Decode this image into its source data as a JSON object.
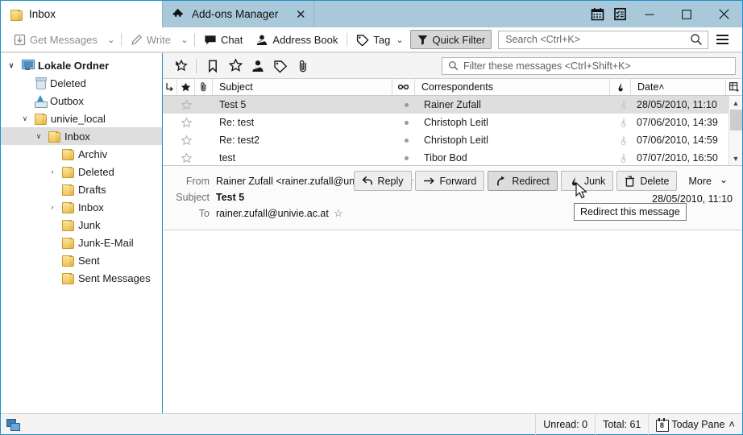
{
  "window": {
    "title_icons": [
      "calendar-icon",
      "tasks-icon"
    ],
    "controls": {
      "minimize": "minimize-icon",
      "maximize": "maximize-icon",
      "close": "close-icon"
    }
  },
  "tabs": [
    {
      "label": "Inbox",
      "icon": "folder-icon",
      "active": false,
      "closable": false
    },
    {
      "label": "Add-ons Manager",
      "icon": "puzzle-piece-icon",
      "active": true,
      "closable": true,
      "close_label": "✕"
    }
  ],
  "toolbar": {
    "get_messages": "Get Messages",
    "write": "Write",
    "chat": "Chat",
    "address_book": "Address Book",
    "tag": "Tag",
    "quick_filter": "Quick Filter",
    "caret": "⌄"
  },
  "search": {
    "placeholder": "Search <Ctrl+K>",
    "value": ""
  },
  "sidebar": {
    "items": [
      {
        "label": "Lokale Ordner",
        "icon": "monitor-icon",
        "indent": 0,
        "twisty": "∨",
        "bold": true,
        "selected": false
      },
      {
        "label": "Deleted",
        "icon": "trash-icon",
        "indent": 1,
        "twisty": "",
        "bold": false,
        "selected": false
      },
      {
        "label": "Outbox",
        "icon": "outbox-icon",
        "indent": 1,
        "twisty": "",
        "bold": false,
        "selected": false
      },
      {
        "label": "univie_local",
        "icon": "folder-icon",
        "indent": 1,
        "twisty": "∨",
        "bold": false,
        "selected": false
      },
      {
        "label": "Inbox",
        "icon": "folder-icon",
        "indent": 2,
        "twisty": "∨",
        "bold": false,
        "selected": true
      },
      {
        "label": "Archiv",
        "icon": "folder-icon",
        "indent": 3,
        "twisty": "",
        "bold": false,
        "selected": false
      },
      {
        "label": "Deleted",
        "icon": "folder-icon",
        "indent": 3,
        "twisty": "›",
        "bold": false,
        "selected": false
      },
      {
        "label": "Drafts",
        "icon": "folder-icon",
        "indent": 3,
        "twisty": "",
        "bold": false,
        "selected": false
      },
      {
        "label": "Inbox",
        "icon": "folder-icon",
        "indent": 3,
        "twisty": "›",
        "bold": false,
        "selected": false
      },
      {
        "label": "Junk",
        "icon": "folder-icon",
        "indent": 3,
        "twisty": "",
        "bold": false,
        "selected": false
      },
      {
        "label": "Junk-E-Mail",
        "icon": "folder-icon",
        "indent": 3,
        "twisty": "",
        "bold": false,
        "selected": false
      },
      {
        "label": "Sent",
        "icon": "folder-icon",
        "indent": 3,
        "twisty": "",
        "bold": false,
        "selected": false
      },
      {
        "label": "Sent Messages",
        "icon": "folder-icon",
        "indent": 3,
        "twisty": "",
        "bold": false,
        "selected": false
      }
    ]
  },
  "quick_filter_bar": {
    "buttons": [
      "unread-filter-icon",
      "starred-bookmark-icon",
      "star-filter-icon",
      "contact-filter-icon",
      "tag-filter-icon",
      "attachment-filter-icon"
    ],
    "filter_placeholder": "Filter these messages <Ctrl+Shift+K>",
    "filter_value": ""
  },
  "message_list": {
    "columns": {
      "thread": "thread-column-icon",
      "star": "star-column-icon",
      "attachment": "attachment-column-icon",
      "subject": "Subject",
      "unread": "unread-column-icon",
      "correspondents": "Correspondents",
      "junk": "junk-column-icon",
      "date": "Date",
      "sort_indicator": "˄",
      "picker": "column-picker-icon"
    },
    "rows": [
      {
        "subject": "Test 5",
        "correspondent": "Rainer Zufall",
        "date": "28/05/2010, 11:10",
        "selected": true,
        "starred": false
      },
      {
        "subject": "Re: test",
        "correspondent": "Christoph Leitl",
        "date": "07/06/2010, 14:39",
        "selected": false,
        "starred": false
      },
      {
        "subject": "Re: test2",
        "correspondent": "Christoph Leitl",
        "date": "07/06/2010, 14:59",
        "selected": false,
        "starred": false
      },
      {
        "subject": "test",
        "correspondent": "Tibor Bod",
        "date": "07/07/2010, 16:50",
        "selected": false,
        "starred": false
      }
    ]
  },
  "message_header": {
    "from_label": "From",
    "from_value": "Rainer Zufall <rainer.zufall@univie.ac.at>",
    "subject_label": "Subject",
    "subject_value": "Test 5",
    "to_label": "To",
    "to_value": "rainer.zufall@univie.ac.at",
    "date": "28/05/2010, 11:10",
    "star_glyph": "☆"
  },
  "message_actions": [
    {
      "label": "Reply",
      "icon": "reply-arrow-icon",
      "hover": false
    },
    {
      "label": "Forward",
      "icon": "forward-arrow-icon",
      "hover": false
    },
    {
      "label": "Redirect",
      "icon": "redirect-arrow-icon",
      "hover": true
    },
    {
      "label": "Junk",
      "icon": "junk-flame-icon",
      "hover": false
    },
    {
      "label": "Delete",
      "icon": "trash-can-icon",
      "hover": false
    },
    {
      "label": "More",
      "icon": "chevron-down-icon",
      "hover": false
    }
  ],
  "tooltip": {
    "text": "Redirect this message"
  },
  "statusbar": {
    "offline_icon": "offline-status-icon",
    "unread": "Unread: 0",
    "total": "Total: 61",
    "today_pane": "Today Pane",
    "today_pane_caret": "˄"
  },
  "colors": {
    "titlebar": "#a9c9da",
    "window_border": "#1e90c8",
    "selection": "#dedede",
    "folder_gold": "#efc558"
  }
}
